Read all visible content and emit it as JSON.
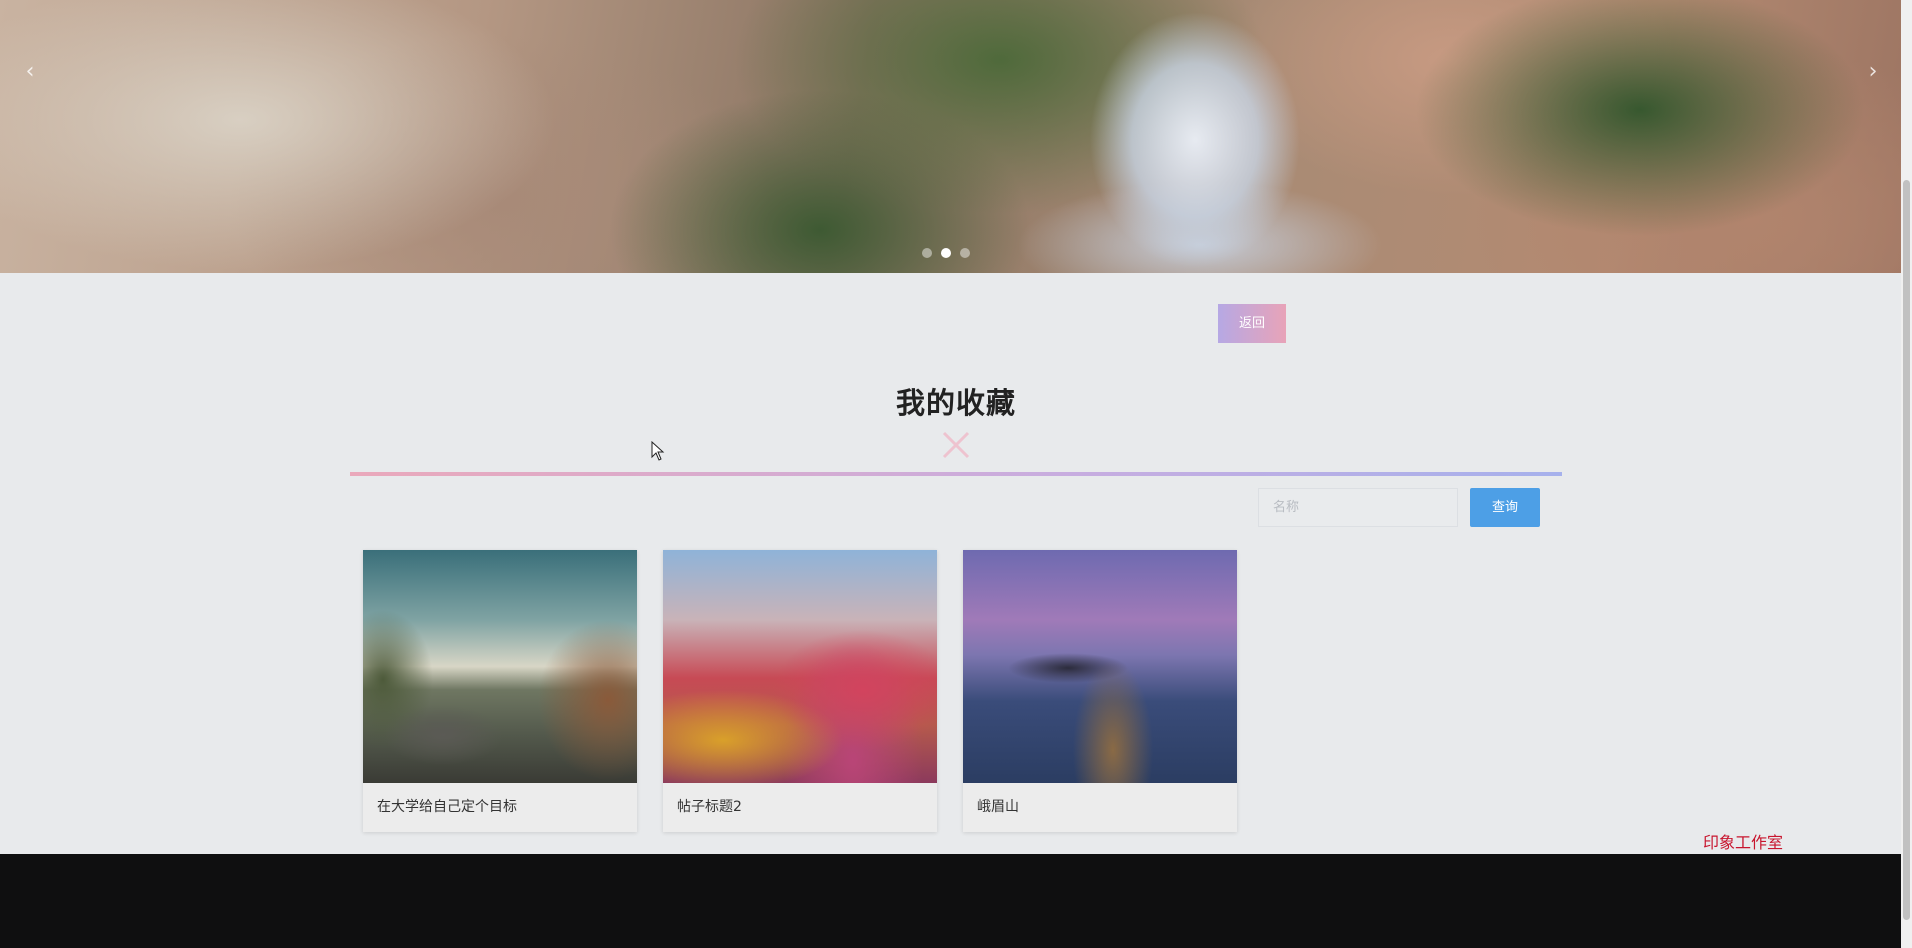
{
  "banner": {
    "prev_arrow": "‹",
    "next_arrow": "›",
    "slide_count": 3,
    "active_slide": 2
  },
  "back_button": {
    "label": "返回"
  },
  "section": {
    "title": "我的收藏"
  },
  "search": {
    "placeholder": "名称",
    "value": "",
    "button_label": "查询"
  },
  "favorites": [
    {
      "title": "在大学给自己定个目标"
    },
    {
      "title": "帖子标题2"
    },
    {
      "title": "峨眉山"
    }
  ],
  "footer": {
    "brand": "印象工作室"
  },
  "colors": {
    "page_bg": "#e8eaec",
    "accent_blue": "#4d9fe6",
    "brand_red": "#c8152e",
    "divider_pink": "#eaa9bb",
    "divider_blue": "#a6b1ec"
  }
}
